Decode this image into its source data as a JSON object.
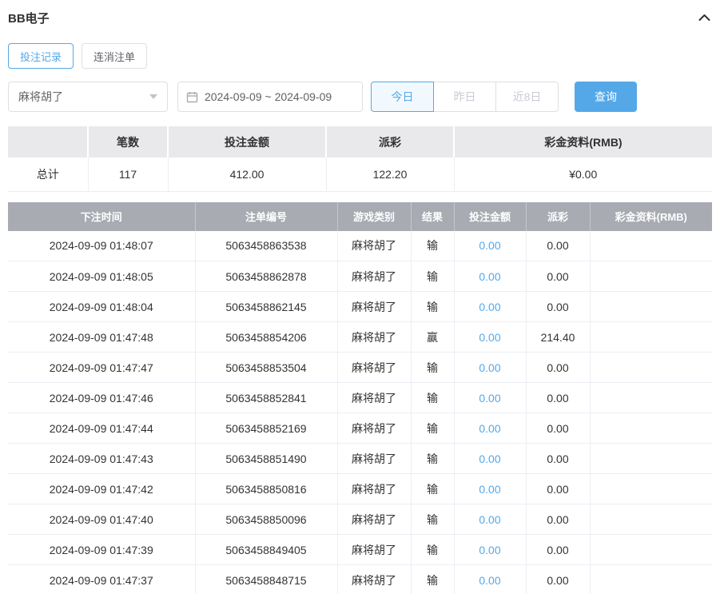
{
  "colors": {
    "accent_blue": "#54a8e8",
    "table_header_bg": "#a8abb2",
    "summary_header_bg": "#e9e9eb"
  },
  "header": {
    "title": "BB电子"
  },
  "tabs": [
    {
      "label": "投注记录",
      "active": true
    },
    {
      "label": "连消注单",
      "active": false
    }
  ],
  "filters": {
    "game_select_value": "麻将胡了",
    "date_range_value": "2024-09-09 ~ 2024-09-09",
    "quick_buttons": [
      {
        "label": "今日",
        "active": true
      },
      {
        "label": "昨日",
        "active": false
      },
      {
        "label": "近8日",
        "active": false
      }
    ],
    "search_label": "查询"
  },
  "summary": {
    "headers": [
      "",
      "笔数",
      "投注金额",
      "派彩",
      "彩金资料(RMB)"
    ],
    "row": {
      "label": "总计",
      "count": "117",
      "bet_amount": "412.00",
      "payout": "122.20",
      "bonus": "¥0.00"
    }
  },
  "table": {
    "headers": [
      "下注时间",
      "注单编号",
      "游戏类别",
      "结果",
      "投注金额",
      "派彩",
      "彩金资料(RMB)"
    ],
    "rows": [
      {
        "time": "2024-09-09 01:48:07",
        "order": "5063458863538",
        "game": "麻将胡了",
        "result": "输",
        "bet": "0.00",
        "payout": "0.00",
        "bonus": ""
      },
      {
        "time": "2024-09-09 01:48:05",
        "order": "5063458862878",
        "game": "麻将胡了",
        "result": "输",
        "bet": "0.00",
        "payout": "0.00",
        "bonus": ""
      },
      {
        "time": "2024-09-09 01:48:04",
        "order": "5063458862145",
        "game": "麻将胡了",
        "result": "输",
        "bet": "0.00",
        "payout": "0.00",
        "bonus": ""
      },
      {
        "time": "2024-09-09 01:47:48",
        "order": "5063458854206",
        "game": "麻将胡了",
        "result": "赢",
        "bet": "0.00",
        "payout": "214.40",
        "bonus": ""
      },
      {
        "time": "2024-09-09 01:47:47",
        "order": "5063458853504",
        "game": "麻将胡了",
        "result": "输",
        "bet": "0.00",
        "payout": "0.00",
        "bonus": ""
      },
      {
        "time": "2024-09-09 01:47:46",
        "order": "5063458852841",
        "game": "麻将胡了",
        "result": "输",
        "bet": "0.00",
        "payout": "0.00",
        "bonus": ""
      },
      {
        "time": "2024-09-09 01:47:44",
        "order": "5063458852169",
        "game": "麻将胡了",
        "result": "输",
        "bet": "0.00",
        "payout": "0.00",
        "bonus": ""
      },
      {
        "time": "2024-09-09 01:47:43",
        "order": "5063458851490",
        "game": "麻将胡了",
        "result": "输",
        "bet": "0.00",
        "payout": "0.00",
        "bonus": ""
      },
      {
        "time": "2024-09-09 01:47:42",
        "order": "5063458850816",
        "game": "麻将胡了",
        "result": "输",
        "bet": "0.00",
        "payout": "0.00",
        "bonus": ""
      },
      {
        "time": "2024-09-09 01:47:40",
        "order": "5063458850096",
        "game": "麻将胡了",
        "result": "输",
        "bet": "0.00",
        "payout": "0.00",
        "bonus": ""
      },
      {
        "time": "2024-09-09 01:47:39",
        "order": "5063458849405",
        "game": "麻将胡了",
        "result": "输",
        "bet": "0.00",
        "payout": "0.00",
        "bonus": ""
      },
      {
        "time": "2024-09-09 01:47:37",
        "order": "5063458848715",
        "game": "麻将胡了",
        "result": "输",
        "bet": "0.00",
        "payout": "0.00",
        "bonus": ""
      }
    ]
  }
}
